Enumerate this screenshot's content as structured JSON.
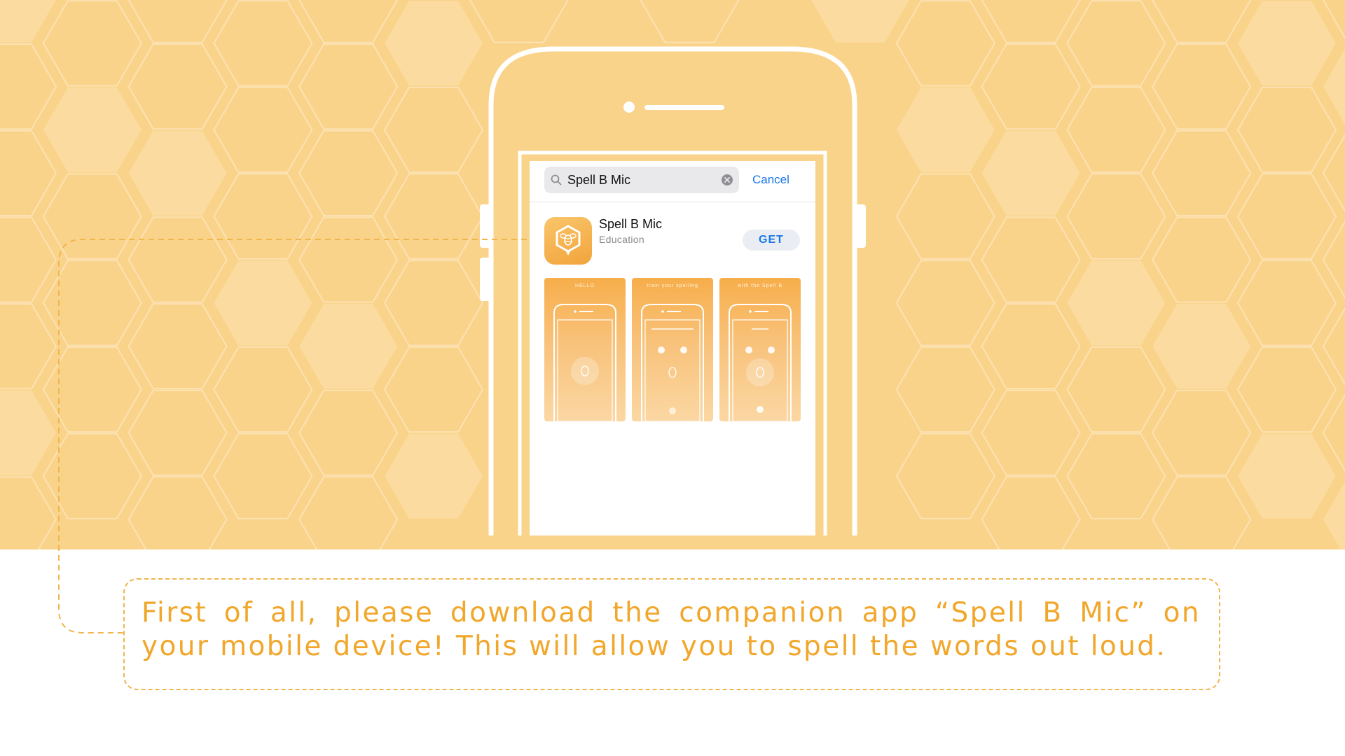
{
  "search": {
    "query": "Spell B Mic",
    "cancel_label": "Cancel"
  },
  "app": {
    "name": "Spell B Mic",
    "category": "Education",
    "get_label": "GET"
  },
  "screenshots": [
    {
      "caption": "HELLO"
    },
    {
      "caption": "train your spelling"
    },
    {
      "caption": "with the Spell B"
    }
  ],
  "caption": "First of all, please download the companion app “Spell B Mic” on your mobile device! This will allow you to spell the words out loud.",
  "colors": {
    "background": "#fad38a",
    "accent": "#f0b54d",
    "text_accent": "#f1a72b",
    "link_blue": "#1a78e6"
  }
}
